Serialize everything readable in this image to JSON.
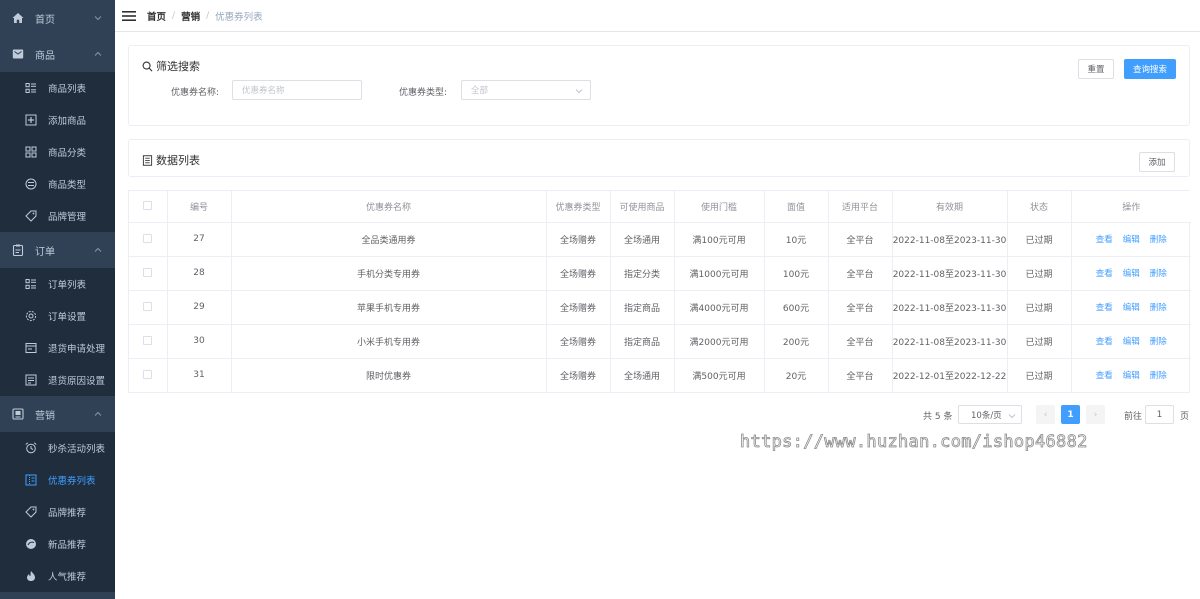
{
  "sidebar": {
    "groups": [
      {
        "label": "首页",
        "icon": "home-icon",
        "expanded": false,
        "items": []
      },
      {
        "label": "商品",
        "icon": "product-icon",
        "expanded": true,
        "items": [
          {
            "label": "商品列表",
            "icon": "list-icon"
          },
          {
            "label": "添加商品",
            "icon": "add-square-icon"
          },
          {
            "label": "商品分类",
            "icon": "grid-icon"
          },
          {
            "label": "商品类型",
            "icon": "type-icon"
          },
          {
            "label": "品牌管理",
            "icon": "tag-icon"
          }
        ]
      },
      {
        "label": "订单",
        "icon": "order-icon",
        "expanded": true,
        "items": [
          {
            "label": "订单列表",
            "icon": "list-icon"
          },
          {
            "label": "订单设置",
            "icon": "settings-icon"
          },
          {
            "label": "退货申请处理",
            "icon": "return-icon"
          },
          {
            "label": "退货原因设置",
            "icon": "reason-icon"
          }
        ]
      },
      {
        "label": "营销",
        "icon": "marketing-icon",
        "expanded": true,
        "items": [
          {
            "label": "秒杀活动列表",
            "icon": "alarm-icon"
          },
          {
            "label": "优惠券列表",
            "icon": "coupon-icon",
            "active": true
          },
          {
            "label": "品牌推荐",
            "icon": "tag-icon"
          },
          {
            "label": "新品推荐",
            "icon": "new-icon"
          },
          {
            "label": "人气推荐",
            "icon": "fire-icon"
          }
        ]
      }
    ]
  },
  "breadcrumb": [
    "首页",
    "营销",
    "优惠券列表"
  ],
  "search": {
    "title": "筛选搜索",
    "reset_label": "重置",
    "query_label": "查询搜索",
    "name_label": "优惠券名称:",
    "name_placeholder": "优惠券名称",
    "type_label": "优惠券类型:",
    "type_placeholder": "全部"
  },
  "list": {
    "title": "数据列表",
    "add_label": "添加"
  },
  "table": {
    "columns": [
      "",
      "编号",
      "优惠券名称",
      "优惠券类型",
      "可使用商品",
      "使用门槛",
      "面值",
      "适用平台",
      "有效期",
      "状态",
      "操作"
    ],
    "actions": [
      "查看",
      "编辑",
      "删除"
    ],
    "rows": [
      [
        "27",
        "全品类通用券",
        "全场赠券",
        "全场通用",
        "满100元可用",
        "10元",
        "全平台",
        "2022-11-08至2023-11-30",
        "已过期"
      ],
      [
        "28",
        "手机分类专用券",
        "全场赠券",
        "指定分类",
        "满1000元可用",
        "100元",
        "全平台",
        "2022-11-08至2023-11-30",
        "已过期"
      ],
      [
        "29",
        "苹果手机专用券",
        "全场赠券",
        "指定商品",
        "满4000元可用",
        "600元",
        "全平台",
        "2022-11-08至2023-11-30",
        "已过期"
      ],
      [
        "30",
        "小米手机专用券",
        "全场赠券",
        "指定商品",
        "满2000元可用",
        "200元",
        "全平台",
        "2022-11-08至2023-11-30",
        "已过期"
      ],
      [
        "31",
        "限时优惠券",
        "全场赠券",
        "全场通用",
        "满500元可用",
        "20元",
        "全平台",
        "2022-12-01至2022-12-22",
        "已过期"
      ]
    ]
  },
  "pagination": {
    "total": "共 5 条",
    "page_size": "10条/页",
    "current_page": "1",
    "prev": "‹",
    "next": "›",
    "goto_label": "前往",
    "goto_value": "1",
    "page_unit": "页"
  },
  "watermark": "https://www.huzhan.com/ishop46882"
}
